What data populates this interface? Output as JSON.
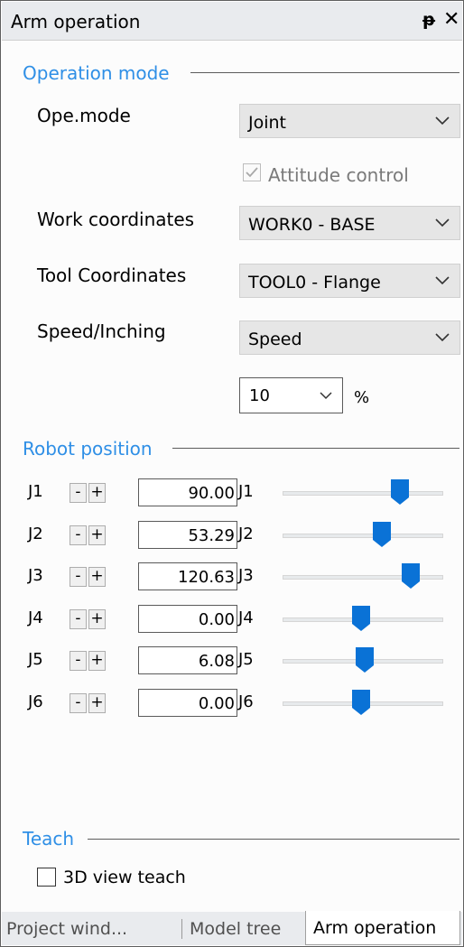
{
  "window": {
    "title": "Arm operation",
    "pin_glyph": "ᵽ",
    "close_glyph": "✕"
  },
  "operation_mode": {
    "section_title": "Operation mode",
    "ope_mode": {
      "label": "Ope.mode",
      "value": "Joint"
    },
    "attitude_control": {
      "label": "Attitude control",
      "checked": true,
      "enabled": false
    },
    "work_coordinates": {
      "label": "Work coordinates",
      "value": "WORK0 - BASE"
    },
    "tool_coordinates": {
      "label": "Tool Coordinates",
      "value": "TOOL0 - Flange"
    },
    "speed_inching": {
      "label": "Speed/Inching",
      "value": "Speed"
    },
    "speed_percent": {
      "value": "10",
      "unit": "%"
    }
  },
  "robot_position": {
    "section_title": "Robot position",
    "minus_label": "-",
    "plus_label": "+",
    "joints": [
      {
        "name": "J1",
        "value": "90.00",
        "slider_fraction": 0.73
      },
      {
        "name": "J2",
        "value": "53.29",
        "slider_fraction": 0.62
      },
      {
        "name": "J3",
        "value": "120.63",
        "slider_fraction": 0.8
      },
      {
        "name": "J4",
        "value": "0.00",
        "slider_fraction": 0.49
      },
      {
        "name": "J5",
        "value": "6.08",
        "slider_fraction": 0.51
      },
      {
        "name": "J6",
        "value": "0.00",
        "slider_fraction": 0.49
      }
    ]
  },
  "teach": {
    "section_title": "Teach",
    "view_teach": {
      "label": "3D view teach",
      "checked": false
    }
  },
  "tabs": [
    {
      "label": "Project wind...",
      "active": false
    },
    {
      "label": "Model tree",
      "active": false
    },
    {
      "label": "Arm operation",
      "active": true
    }
  ],
  "colors": {
    "accent": "#2f8fe6",
    "slider_thumb": "#0a72d6"
  }
}
